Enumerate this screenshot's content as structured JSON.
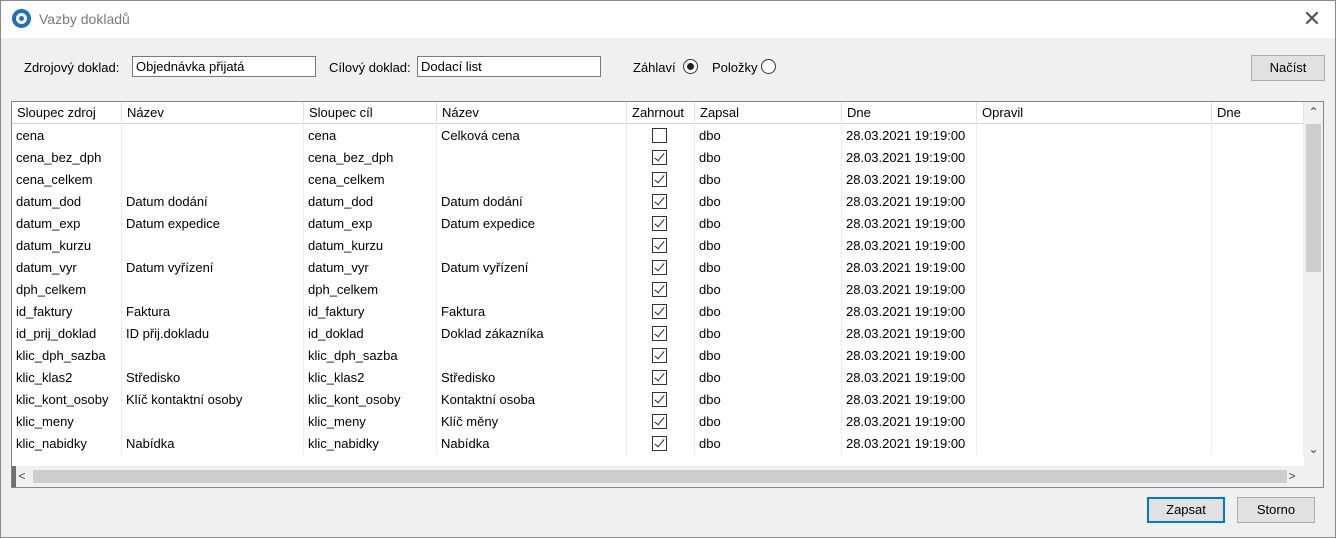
{
  "window": {
    "title": "Vazby dokladů",
    "close_glyph": "✕"
  },
  "form": {
    "source_label": "Zdrojový doklad:",
    "source_value": "Objednávka přijatá",
    "target_label": "Cílový doklad:",
    "target_value": "Dodací list",
    "header_radio_label": "Záhlaví",
    "items_radio_label": "Položky",
    "header_radio_checked": true,
    "items_radio_checked": false,
    "load_button": "Načíst"
  },
  "table": {
    "columns": [
      "Sloupec zdroj",
      "Název",
      "Sloupec cíl",
      "Název",
      "Zahrnout",
      "Zapsal",
      "Dne",
      "Opravil",
      "Dne"
    ],
    "rows": [
      {
        "src": "cena",
        "src_name": "",
        "dst": "cena",
        "dst_name": "Celková cena",
        "include": false,
        "by": "dbo",
        "date": "28.03.2021 19:19:00",
        "edited": "",
        "edited_date": ""
      },
      {
        "src": "cena_bez_dph",
        "src_name": "",
        "dst": "cena_bez_dph",
        "dst_name": "",
        "include": true,
        "by": "dbo",
        "date": "28.03.2021 19:19:00",
        "edited": "",
        "edited_date": ""
      },
      {
        "src": "cena_celkem",
        "src_name": "",
        "dst": "cena_celkem",
        "dst_name": "",
        "include": true,
        "by": "dbo",
        "date": "28.03.2021 19:19:00",
        "edited": "",
        "edited_date": ""
      },
      {
        "src": "datum_dod",
        "src_name": "Datum dodání",
        "dst": "datum_dod",
        "dst_name": "Datum dodání",
        "include": true,
        "by": "dbo",
        "date": "28.03.2021 19:19:00",
        "edited": "",
        "edited_date": ""
      },
      {
        "src": "datum_exp",
        "src_name": "Datum expedice",
        "dst": "datum_exp",
        "dst_name": "Datum expedice",
        "include": true,
        "by": "dbo",
        "date": "28.03.2021 19:19:00",
        "edited": "",
        "edited_date": ""
      },
      {
        "src": "datum_kurzu",
        "src_name": "",
        "dst": "datum_kurzu",
        "dst_name": "",
        "include": true,
        "by": "dbo",
        "date": "28.03.2021 19:19:00",
        "edited": "",
        "edited_date": ""
      },
      {
        "src": "datum_vyr",
        "src_name": "Datum vyřízení",
        "dst": "datum_vyr",
        "dst_name": "Datum vyřízení",
        "include": true,
        "by": "dbo",
        "date": "28.03.2021 19:19:00",
        "edited": "",
        "edited_date": ""
      },
      {
        "src": "dph_celkem",
        "src_name": "",
        "dst": "dph_celkem",
        "dst_name": "",
        "include": true,
        "by": "dbo",
        "date": "28.03.2021 19:19:00",
        "edited": "",
        "edited_date": ""
      },
      {
        "src": "id_faktury",
        "src_name": "Faktura",
        "dst": "id_faktury",
        "dst_name": "Faktura",
        "include": true,
        "by": "dbo",
        "date": "28.03.2021 19:19:00",
        "edited": "",
        "edited_date": ""
      },
      {
        "src": "id_prij_doklad",
        "src_name": "ID přij.dokladu",
        "dst": "id_doklad",
        "dst_name": "Doklad zákazníka",
        "include": true,
        "by": "dbo",
        "date": "28.03.2021 19:19:00",
        "edited": "",
        "edited_date": ""
      },
      {
        "src": "klic_dph_sazba",
        "src_name": "",
        "dst": "klic_dph_sazba",
        "dst_name": "",
        "include": true,
        "by": "dbo",
        "date": "28.03.2021 19:19:00",
        "edited": "",
        "edited_date": ""
      },
      {
        "src": "klic_klas2",
        "src_name": "Středisko",
        "dst": "klic_klas2",
        "dst_name": "Středisko",
        "include": true,
        "by": "dbo",
        "date": "28.03.2021 19:19:00",
        "edited": "",
        "edited_date": ""
      },
      {
        "src": "klic_kont_osoby",
        "src_name": "Klíč kontaktní osoby",
        "dst": "klic_kont_osoby",
        "dst_name": "Kontaktní osoba",
        "include": true,
        "by": "dbo",
        "date": "28.03.2021 19:19:00",
        "edited": "",
        "edited_date": ""
      },
      {
        "src": "klic_meny",
        "src_name": "",
        "dst": "klic_meny",
        "dst_name": "Klíč měny",
        "include": true,
        "by": "dbo",
        "date": "28.03.2021 19:19:00",
        "edited": "",
        "edited_date": ""
      },
      {
        "src": "klic_nabidky",
        "src_name": "Nabídka",
        "dst": "klic_nabidky",
        "dst_name": "Nabídka",
        "include": true,
        "by": "dbo",
        "date": "28.03.2021 19:19:00",
        "edited": "",
        "edited_date": ""
      }
    ]
  },
  "scroll": {
    "up": "⌃",
    "down": "⌄",
    "left": "<",
    "right": ">"
  },
  "footer": {
    "save_button": "Zapsat",
    "cancel_button": "Storno"
  }
}
